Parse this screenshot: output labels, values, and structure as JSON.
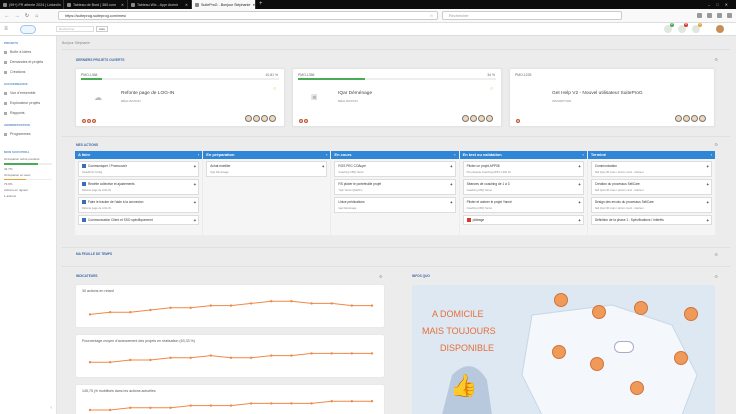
{
  "browser": {
    "tabs": [
      {
        "label": "(99+) FR attente 2024 | LinkedIn",
        "active": false
      },
      {
        "label": "Tableau de Bord | 360.com",
        "active": false
      },
      {
        "label": "Tableau Wix - Appr Avenir",
        "active": false
      },
      {
        "label": "SuiteProG - Bonjour Stéphanie",
        "active": true
      }
    ],
    "url": "https://suiteprog.suiteprog.com/mes/",
    "search_placeholder": "Rechercher"
  },
  "app": {
    "search_placeholder": "Rechercher",
    "search_button": "Aide",
    "badges": [
      {
        "count": "2",
        "color": "#4aab57"
      },
      {
        "count": "8",
        "color": "#d9362a"
      },
      {
        "count": "1",
        "color": "#e8a23a"
      }
    ]
  },
  "sidebar": {
    "sections": [
      {
        "title": "PROJETS",
        "items": [
          "Boîte à Idées",
          "Demandes et projets",
          "Créations"
        ]
      },
      {
        "title": "GOUVERNANCE",
        "items": [
          "Vue d'ensemble",
          "Explorateur projets",
          "Rapports"
        ]
      },
      {
        "title": "ADMINISTRATION",
        "items": [
          "Programmes"
        ]
      }
    ],
    "status_title": "MON SUIVI PROJ.",
    "metrics": [
      {
        "label": "Occupation sobre pondéré",
        "value": 0.7,
        "color": "#4aab57",
        "text": "44.7%"
      },
      {
        "label": "Occupation en avec",
        "value": 0.45,
        "color": "#e8a23a",
        "text": "73.9%"
      },
      {
        "label": "Actions en rigueur",
        "value": 0,
        "color": "#d9362a",
        "text": "1 actions"
      }
    ]
  },
  "page": {
    "breadcrumb": "Bonjour Stéphanie",
    "section_projects": "DERNIERS PROJETS OUVERTS",
    "section_actions": "MES ACTIONS",
    "section_time": "MA FEUILLE DE TEMPS",
    "section_indicators": "INDICATEURS",
    "section_info": "INFOS QUO"
  },
  "projects": [
    {
      "code": "PMO-1368",
      "pct": "10,81 %",
      "progress": 0.108,
      "title": "Refonte page de LOG-IN",
      "status": "RÉALISATION"
    },
    {
      "code": "PMO-1356",
      "pct": "34 %",
      "progress": 0.34,
      "title": "IQar Déménage",
      "status": "RÉALISATION"
    },
    {
      "code": "PMO-1225",
      "pct": "",
      "progress": 0,
      "title": "Get Help V2 - Nouvel utilisateur SuiteProG",
      "status": "INSCRIPTION"
    }
  ],
  "kanban": [
    {
      "title": "A faire",
      "cards": [
        {
          "title": "Communiquer / Promouvoir",
          "sub": "SuiteProG Config"
        },
        {
          "title": "Recette collective et ajustements",
          "sub": "Refonte page de LOG-IN"
        },
        {
          "title": "Faire le tracker de l'aide à la connexion",
          "sub": "Refonte page de LOG-IN"
        },
        {
          "title": "Communication Client et SSO spécifiquement",
          "sub": ""
        }
      ]
    },
    {
      "title": "En préparation",
      "cards": [
        {
          "title": "Achat mobilier",
          "sub": "IQar Déménage"
        }
      ]
    },
    {
      "title": "En cours",
      "cards": [
        {
          "title": "ROS PEC COAupe",
          "sub": "Coaching CBQ Yanné"
        },
        {
          "title": "RS piloter le portefeuille projet",
          "sub": "Yqar Yanné QUEN ts"
        },
        {
          "title": "Unice prédications",
          "sub": "Iqar Déménage"
        }
      ]
    },
    {
      "title": "En test ou validation",
      "cards": [
        {
          "title": "Piloter un projet APP08",
          "sub": "Pré-clausule Coaching APP1 1 002 16"
        },
        {
          "title": "Séances de coaching de 1 à 3",
          "sub": "Coaching CBQ Yanné"
        },
        {
          "title": "Piloter et animer le projet Yanné",
          "sub": "Coaching CBQ Yanné"
        },
        {
          "title": "plâtrage",
          "sub": "",
          "alert": true
        }
      ]
    },
    {
      "title": "Terminé",
      "cards": [
        {
          "title": "Communication",
          "sub": "Sell Quot 30 mars / sintron ment - intérieur"
        },
        {
          "title": "Création du processus SellCare",
          "sub": "Sell Quot 30 mars / sintron ment - intérieur"
        },
        {
          "title": "Design des envois du processus SellCare",
          "sub": "Sell Quot 30 mars / sintron ment - intérieur"
        },
        {
          "title": "Définition de la phase 1 : Spécifications / Intérêts",
          "sub": ""
        }
      ]
    }
  ],
  "indicators": [
    {
      "title": "30 actions en retard",
      "values": [
        3,
        4,
        4,
        5,
        6,
        6,
        7,
        7,
        8,
        9,
        9,
        8,
        8,
        7,
        7
      ]
    },
    {
      "title": "Pourcentage moyen d'avancement des projets en réalisation (63,33 %)",
      "values": [
        4,
        4,
        5,
        5,
        6,
        6,
        7,
        6,
        6,
        7,
        7,
        8,
        8,
        8,
        8
      ]
    },
    {
      "title": "145,75 j/h mobilisés dans les actions actuelles",
      "values": [
        5,
        5,
        6,
        6,
        6,
        7,
        7,
        7,
        8,
        8,
        8,
        8,
        9,
        9,
        9
      ]
    }
  ],
  "info_banner": {
    "line1": "A DOMICILE",
    "line2": "MAIS TOUJOURS",
    "line3": "DISPONIBLE"
  }
}
